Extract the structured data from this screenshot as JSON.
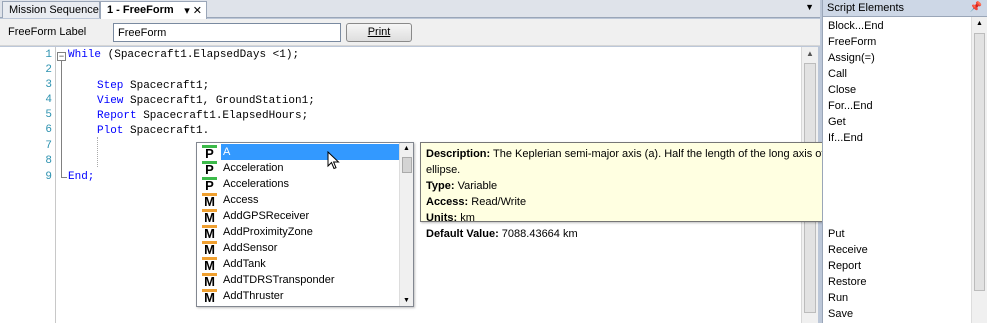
{
  "tabs": [
    {
      "label": "Mission Sequence"
    },
    {
      "label": "1 - FreeForm"
    }
  ],
  "labelbar": {
    "label": "FreeForm Label",
    "value": "FreeForm",
    "print_label": "Print"
  },
  "editor": {
    "line_numbers": [
      "1",
      "2",
      "3",
      "4",
      "5",
      "6",
      "7",
      "8",
      "9"
    ],
    "lines": {
      "l1_kw": "While",
      "l1_rest": " (Spacecraft1.ElapsedDays <1);",
      "l3_kw": "Step",
      "l3_rest": " Spacecraft1;",
      "l4_kw": "View",
      "l4_rest": " Spacecraft1, GroundStation1;",
      "l5_kw": "Report",
      "l5_rest": " Spacecraft1.ElapsedHours;",
      "l6_kw": "Plot",
      "l6_rest": " Spacecraft1.",
      "l9_kw": "End;"
    }
  },
  "autocomplete": {
    "items": [
      {
        "badge": "P",
        "name": "A"
      },
      {
        "badge": "P",
        "name": "Acceleration"
      },
      {
        "badge": "P",
        "name": "Accelerations"
      },
      {
        "badge": "M",
        "name": "Access"
      },
      {
        "badge": "M",
        "name": "AddGPSReceiver"
      },
      {
        "badge": "M",
        "name": "AddProximityZone"
      },
      {
        "badge": "M",
        "name": "AddSensor"
      },
      {
        "badge": "M",
        "name": "AddTank"
      },
      {
        "badge": "M",
        "name": "AddTDRSTransponder"
      },
      {
        "badge": "M",
        "name": "AddThruster"
      }
    ]
  },
  "tooltip": {
    "desc_label": "Description:",
    "desc": " The Keplerian semi-major axis (a). Half the length of the long axis of the orbit ellipse.",
    "type_label": "Type:",
    "type": " Variable",
    "access_label": "Access:",
    "access": " Read/Write",
    "units_label": "Units:",
    "units": " km",
    "default_label": "Default Value:",
    "default": " 7088.43664 km"
  },
  "panel": {
    "title": "Script Elements",
    "items": [
      "Block...End",
      "FreeForm",
      "Assign(=)",
      "Call",
      "Close",
      "For...End",
      "Get",
      "If...End",
      "Put",
      "Receive",
      "Report",
      "Restore",
      "Run",
      "Save"
    ]
  },
  "colors": {
    "keyword": "#0000ff",
    "selection": "#3399ff",
    "tooltip_bg": "#ffffe1",
    "badge_p": "#3cba4a",
    "badge_m": "#f0a030"
  }
}
